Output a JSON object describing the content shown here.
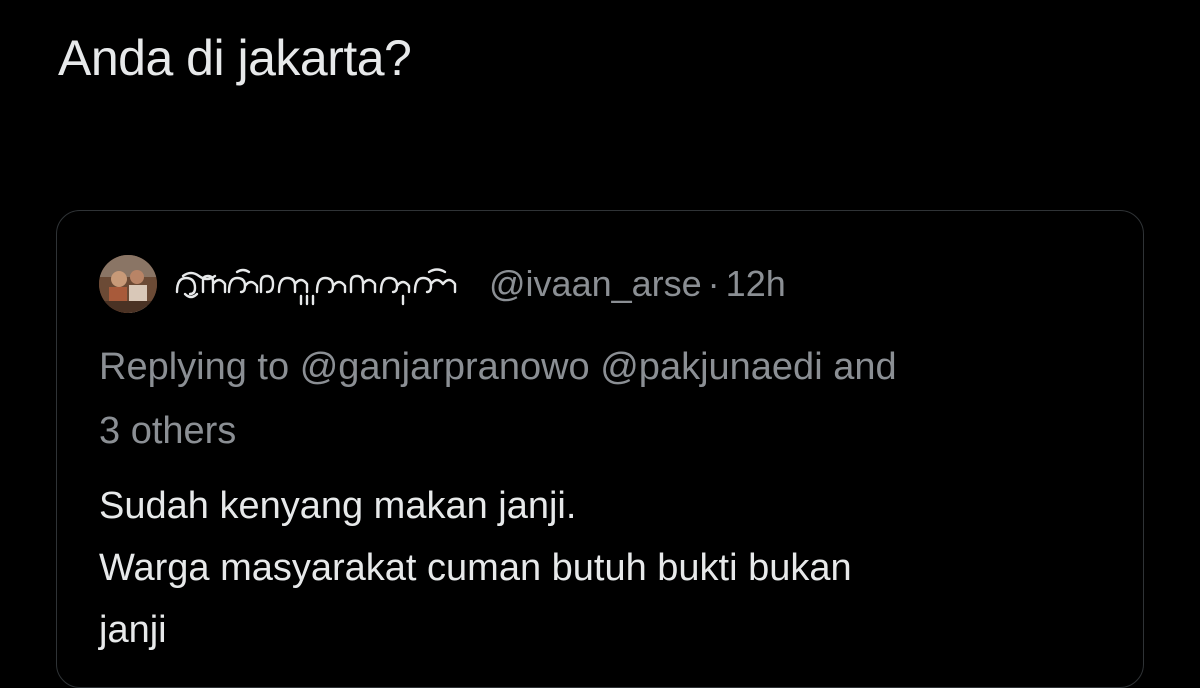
{
  "tweet": {
    "text": "Anda di jakarta?"
  },
  "quoted_tweet": {
    "display_name": "ꦲꦶꦮꦤ꧀ꦲꦂꦱꦺ",
    "handle": "@ivaan_arse",
    "separator": "·",
    "timestamp": "12h",
    "reply_prefix": "Replying to",
    "reply_mentions": [
      "@ganjarpranowo",
      "@pakjunaedi"
    ],
    "reply_and": "and",
    "reply_others": "3 others",
    "body_lines": [
      "Sudah kenyang makan janji.",
      "Warga masyarakat cuman butuh bukti bukan",
      "janji"
    ]
  },
  "colors": {
    "background": "#000000",
    "primary_text": "#e7e9ea",
    "secondary_text": "#8b8f94",
    "border": "#2f3336"
  },
  "icons": {
    "avatar": "user-avatar-photo"
  }
}
